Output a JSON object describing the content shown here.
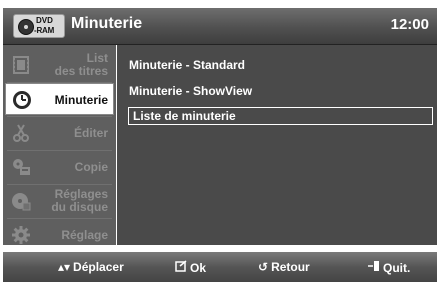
{
  "header": {
    "disc_top": "DVD",
    "disc_bottom": "-RAM",
    "title": "Minuterie",
    "clock": "12:00"
  },
  "sidebar": {
    "items": [
      {
        "label_line1": "List",
        "label_line2": "des titres",
        "icon": "film-strip-icon",
        "active": false
      },
      {
        "label_line1": "Minuterie",
        "label_line2": "",
        "icon": "clock-icon",
        "active": true
      },
      {
        "label_line1": "Éditer",
        "label_line2": "",
        "icon": "scissors-icon",
        "active": false
      },
      {
        "label_line1": "Copie",
        "label_line2": "",
        "icon": "copy-icon",
        "active": false
      },
      {
        "label_line1": "Réglages",
        "label_line2": "du disque",
        "icon": "disc-settings-icon",
        "active": false
      },
      {
        "label_line1": "Réglage",
        "label_line2": "",
        "icon": "gear-icon",
        "active": false
      }
    ]
  },
  "menu": {
    "items": [
      {
        "label": "Minuterie - Standard",
        "selected": false
      },
      {
        "label": "Minuterie - ShowView",
        "selected": false
      },
      {
        "label": "Liste de minuterie",
        "selected": true
      }
    ]
  },
  "footer": {
    "move_label": "Déplacer",
    "ok_label": "Ok",
    "return_label": "Retour",
    "exit_label": "Quit."
  },
  "colors": {
    "panel": "#4a4a4a",
    "sidebar": "#5f5f5f",
    "active_item": "#ffffff"
  }
}
